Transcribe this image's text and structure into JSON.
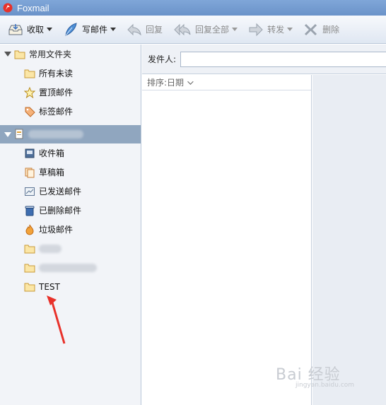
{
  "window": {
    "title": "Foxmail"
  },
  "toolbar": {
    "receive": "收取",
    "compose": "写邮件",
    "reply": "回复",
    "reply_all": "回复全部",
    "forward": "转发",
    "delete": "删除"
  },
  "sidebar": {
    "common_folder": "常用文件夹",
    "common_items": [
      "所有未读",
      "置顶邮件",
      "标签邮件"
    ],
    "account_items": [
      "收件箱",
      "草稿箱",
      "已发送邮件",
      "已删除邮件",
      "垃圾邮件"
    ],
    "custom_folder_3": "TEST"
  },
  "search": {
    "sender_label": "发件人:",
    "sender_value": ""
  },
  "list": {
    "sort_label": "排序:日期"
  },
  "watermark": {
    "main": "Bai 经验",
    "sub": "jingyan.baidu.com"
  },
  "colors": {
    "titlebar": "#7fa6d8",
    "account_header": "#90a6bf",
    "arrow": "#e8312a"
  }
}
